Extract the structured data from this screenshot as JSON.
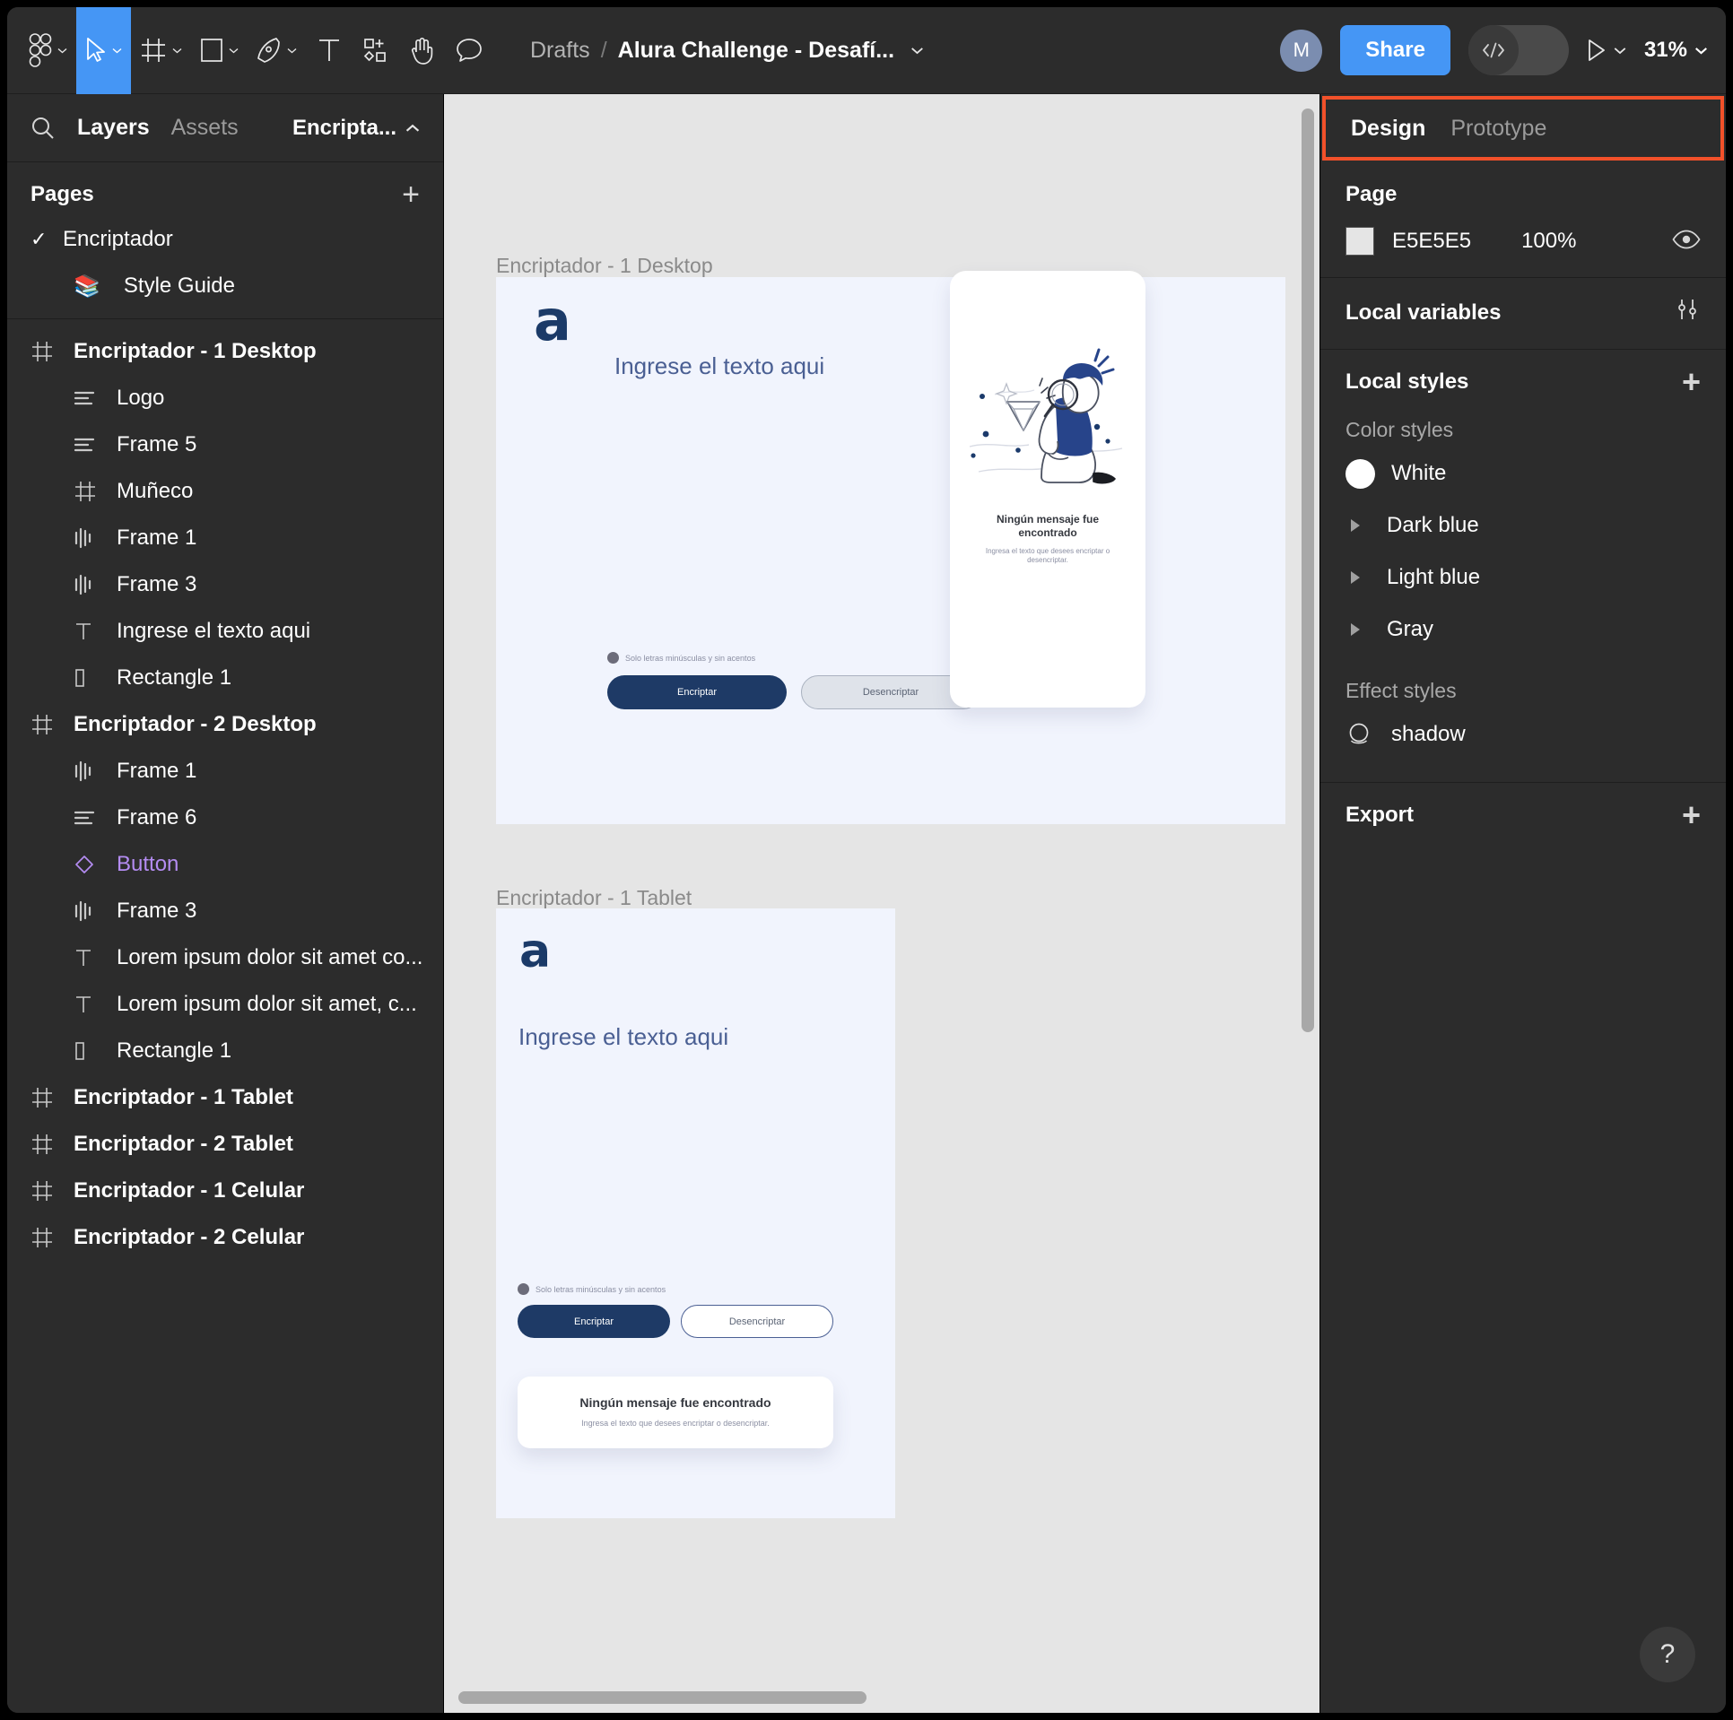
{
  "toolbar": {
    "tools": [
      {
        "name": "figma-menu-icon",
        "caret": true
      },
      {
        "name": "move-tool-icon",
        "caret": true,
        "active": true
      },
      {
        "name": "frame-tool-icon",
        "caret": true
      },
      {
        "name": "shape-tool-icon",
        "caret": true
      },
      {
        "name": "pen-tool-icon",
        "caret": true
      },
      {
        "name": "text-tool-icon",
        "caret": false
      },
      {
        "name": "resources-tool-icon",
        "caret": false
      },
      {
        "name": "hand-tool-icon",
        "caret": false
      },
      {
        "name": "comment-tool-icon",
        "caret": false
      }
    ],
    "breadcrumb_root": "Drafts",
    "breadcrumb_sep": "/",
    "breadcrumb_file": "Alura Challenge - Desafí...",
    "avatar_initial": "M",
    "share_label": "Share",
    "dev_mode_icon": "code-icon",
    "present_icon": "play-icon",
    "zoom_level": "31%"
  },
  "left_panel": {
    "search_icon": "search-icon",
    "tabs": [
      {
        "label": "Layers",
        "active": true
      },
      {
        "label": "Assets",
        "active": false
      }
    ],
    "file_name": "Encripta...",
    "pages_title": "Pages",
    "pages_add_icon": "plus-icon",
    "pages": [
      {
        "label": "Encriptador",
        "selected": true,
        "icon": "check-icon"
      },
      {
        "label": "Style Guide",
        "selected": false,
        "icon": "books-emoji"
      }
    ],
    "layers": [
      {
        "label": "Encriptador - 1 Desktop",
        "icon": "frame-icon",
        "depth": 0,
        "bold": true
      },
      {
        "label": "Logo",
        "icon": "autolayout-horizontal-icon",
        "depth": 1,
        "bold": false
      },
      {
        "label": "Frame 5",
        "icon": "autolayout-horizontal-icon",
        "depth": 1,
        "bold": false
      },
      {
        "label": "Muñeco",
        "icon": "frame-icon",
        "depth": 1,
        "bold": false
      },
      {
        "label": "Frame 1",
        "icon": "autolayout-vertical-icon",
        "depth": 1,
        "bold": false
      },
      {
        "label": "Frame 3",
        "icon": "autolayout-vertical-icon",
        "depth": 1,
        "bold": false
      },
      {
        "label": "Ingrese el texto aqui",
        "icon": "text-layer-icon",
        "depth": 1,
        "bold": false
      },
      {
        "label": "Rectangle 1",
        "icon": "rectangle-layer-icon",
        "depth": 1,
        "bold": false
      },
      {
        "label": "Encriptador - 2 Desktop",
        "icon": "frame-icon",
        "depth": 0,
        "bold": true
      },
      {
        "label": "Frame 1",
        "icon": "autolayout-vertical-icon",
        "depth": 1,
        "bold": false
      },
      {
        "label": "Frame 6",
        "icon": "autolayout-horizontal-icon",
        "depth": 1,
        "bold": false
      },
      {
        "label": "Button",
        "icon": "component-icon",
        "depth": 1,
        "bold": false,
        "component": true
      },
      {
        "label": "Frame 3",
        "icon": "autolayout-vertical-icon",
        "depth": 1,
        "bold": false
      },
      {
        "label": "Lorem ipsum dolor sit amet co...",
        "icon": "text-layer-icon",
        "depth": 1,
        "bold": false
      },
      {
        "label": "Lorem ipsum dolor sit amet, c...",
        "icon": "text-layer-icon",
        "depth": 1,
        "bold": false
      },
      {
        "label": "Rectangle 1",
        "icon": "rectangle-layer-icon",
        "depth": 1,
        "bold": false
      },
      {
        "label": "Encriptador - 1 Tablet",
        "icon": "frame-icon",
        "depth": 0,
        "bold": true
      },
      {
        "label": "Encriptador - 2 Tablet",
        "icon": "frame-icon",
        "depth": 0,
        "bold": true
      },
      {
        "label": "Encriptador - 1 Celular",
        "icon": "frame-icon",
        "depth": 0,
        "bold": true
      },
      {
        "label": "Encriptador - 2 Celular",
        "icon": "frame-icon",
        "depth": 0,
        "bold": true
      }
    ]
  },
  "right_panel": {
    "tabs": [
      {
        "label": "Design",
        "active": true
      },
      {
        "label": "Prototype",
        "active": false
      }
    ],
    "highlight_color": "#f2512a",
    "page_section": {
      "title": "Page",
      "color_hex": "E5E5E5",
      "opacity": "100%",
      "visibility_icon": "eye-icon"
    },
    "local_variables": {
      "title": "Local variables",
      "icon": "sliders-icon"
    },
    "local_styles": {
      "title": "Local styles",
      "add_icon": "plus-icon",
      "color_styles_label": "Color styles",
      "color_styles": [
        {
          "label": "White",
          "type": "swatch",
          "color": "#ffffff"
        },
        {
          "label": "Dark blue",
          "type": "group"
        },
        {
          "label": "Light blue",
          "type": "group"
        },
        {
          "label": "Gray",
          "type": "group"
        }
      ],
      "effect_styles_label": "Effect styles",
      "effect_styles": [
        {
          "label": "shadow",
          "icon": "shadow-icon"
        }
      ]
    },
    "export": {
      "title": "Export",
      "add_icon": "plus-icon"
    },
    "help_label": "?"
  },
  "canvas": {
    "background": "#e5e5e5",
    "frames": [
      {
        "label": "Encriptador - 1 Desktop",
        "logo": "a",
        "placeholder": "Ingrese el texto aqui",
        "hint": "Solo letras minúsculas y sin acentos",
        "encrypt_label": "Encriptar",
        "decrypt_label": "Desencriptar",
        "card_title": "Ningún mensaje fue encontrado",
        "card_sub": "Ingresa el texto que desees encriptar o desencriptar.",
        "illustration": "person-with-magnifier-and-diamond"
      },
      {
        "label": "Encriptador - 1 Tablet",
        "logo": "a",
        "placeholder": "Ingrese el texto aqui",
        "hint": "Solo letras minúsculas y sin acentos",
        "encrypt_label": "Encriptar",
        "decrypt_label": "Desencriptar",
        "card_title": "Ningún mensaje fue encontrado",
        "card_sub": "Ingresa el texto que desees encriptar o desencriptar."
      }
    ]
  }
}
